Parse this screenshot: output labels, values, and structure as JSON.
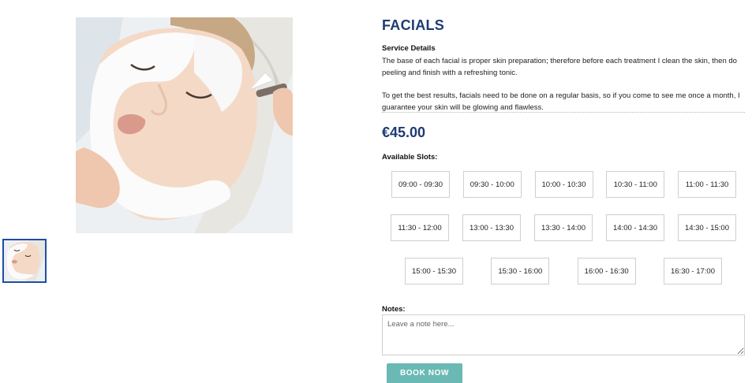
{
  "product": {
    "title": "FACIALS",
    "image_alt": "woman receiving facial mask treatment"
  },
  "details": {
    "label": "Service Details",
    "paragraphs": [
      "The base of each facial is proper skin preparation; therefore before each treatment I clean the skin, then do peeling and finish with a refreshing tonic.",
      "To get the best results, facials need to be done on a regular basis, so if you come to see me once a month, I guarantee your skin will be glowing and flawless."
    ]
  },
  "price": "€45.00",
  "slots": {
    "label": "Available Slots:",
    "times": [
      "09:00 - 09:30",
      "09:30 - 10:00",
      "10:00 - 10:30",
      "10:30 - 11:00",
      "11:00 - 11:30",
      "11:30 - 12:00",
      "13:00 - 13:30",
      "13:30 - 14:00",
      "14:00 - 14:30",
      "14:30 - 15:00",
      "15:00 - 15:30",
      "15:30 - 16:00",
      "16:00 - 16:30",
      "16:30 - 17:00"
    ]
  },
  "notes": {
    "label": "Notes:",
    "placeholder": "Leave a note here...",
    "value": ""
  },
  "book_button": "BOOK NOW",
  "colors": {
    "title": "#1f3b73",
    "thumb_border": "#1d4fa3",
    "book_button": "#6ab9b4"
  }
}
